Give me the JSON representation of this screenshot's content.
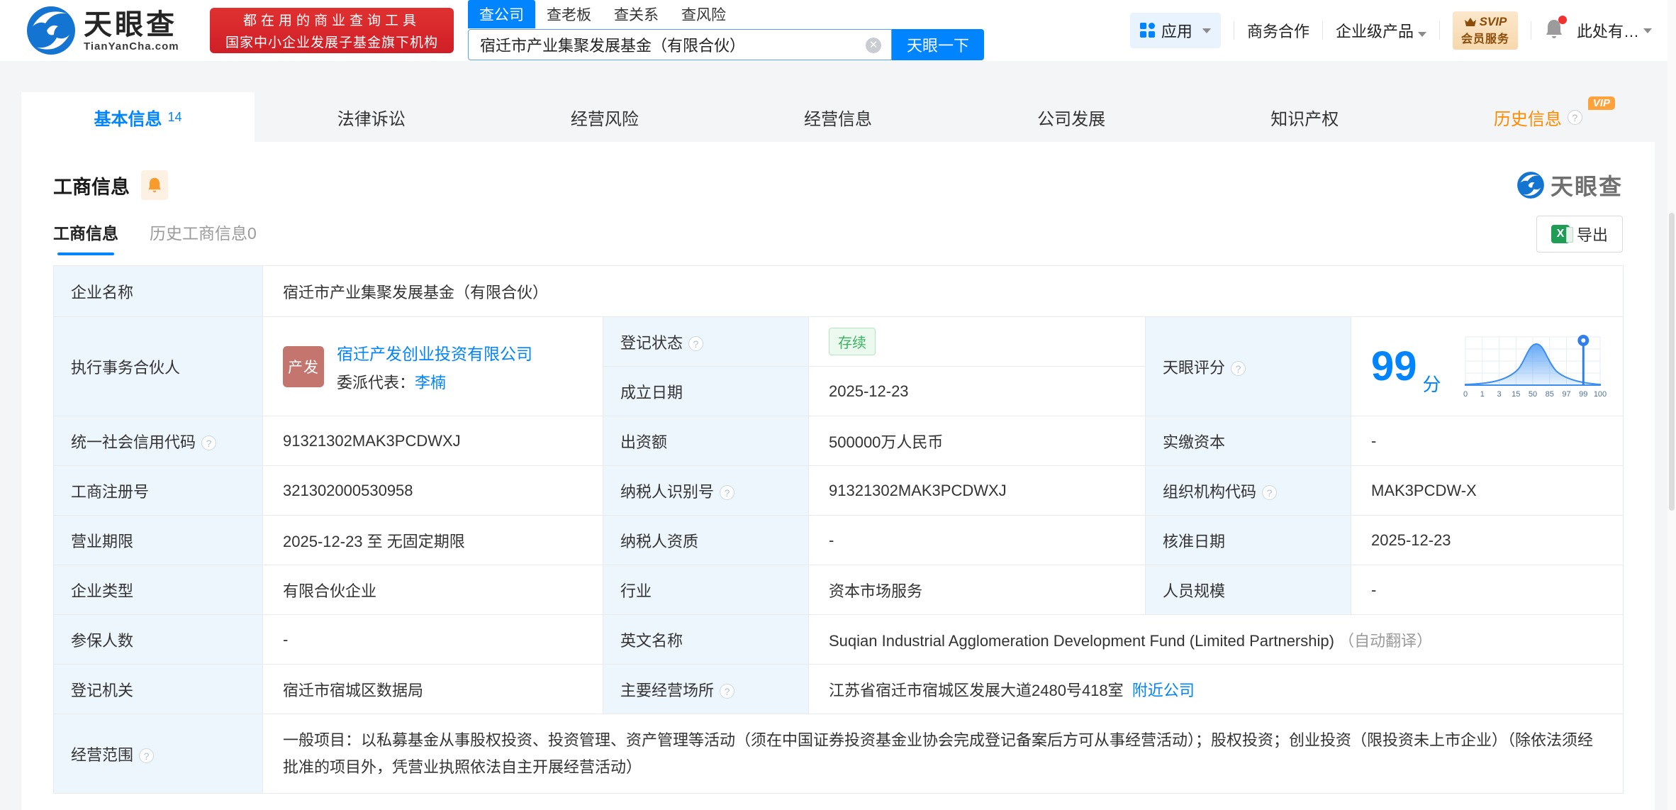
{
  "brand": {
    "logo_text": "天眼查",
    "domain": "TianYanCha.com",
    "promo_line1": "都在用的商业查询工具",
    "promo_line2": "国家中小企业发展子基金旗下机构"
  },
  "search": {
    "tabs": [
      "查公司",
      "查老板",
      "查关系",
      "查风险"
    ],
    "active_tab": "查公司",
    "value": "宿迁市产业集聚发展基金（有限合伙）",
    "button": "天眼一下"
  },
  "topnav": {
    "apps": "应用",
    "coop": "商务合作",
    "enterprise": "企业级产品",
    "svip_top": "SVIP",
    "svip_bottom": "会员服务",
    "more": "此处有…"
  },
  "tabs": [
    {
      "label": "基本信息",
      "count": "14",
      "active": true
    },
    {
      "label": "法律诉讼"
    },
    {
      "label": "经营风险"
    },
    {
      "label": "经营信息"
    },
    {
      "label": "公司发展"
    },
    {
      "label": "知识产权"
    },
    {
      "label": "历史信息",
      "vip_badge": "VIP"
    }
  ],
  "section": {
    "title": "工商信息",
    "subtab_active": "工商信息",
    "subtab_history": "历史工商信息0",
    "export": "导出",
    "watermark": "天眼查"
  },
  "fields": {
    "company_name": {
      "label": "企业名称",
      "value": "宿迁市产业集聚发展基金（有限合伙）"
    },
    "executive_partner": {
      "label": "执行事务合伙人",
      "avatar_text": "产发",
      "company": "宿迁产发创业投资有限公司",
      "deputy_label": "委派代表：",
      "deputy": "李楠"
    },
    "registration_status": {
      "label": "登记状态",
      "value": "存续"
    },
    "establish_date": {
      "label": "成立日期",
      "value": "2025-12-23"
    },
    "tianyan_score": {
      "label": "天眼评分",
      "score": "99",
      "unit": "分"
    },
    "credit_code": {
      "label": "统一社会信用代码",
      "value": "91321302MAK3PCDWXJ"
    },
    "contribution": {
      "label": "出资额",
      "value": "500000万人民币"
    },
    "paid_capital": {
      "label": "实缴资本",
      "value": "-"
    },
    "registration_number": {
      "label": "工商注册号",
      "value": "321302000530958"
    },
    "taxpayer_id": {
      "label": "纳税人识别号",
      "value": "91321302MAK3PCDWXJ"
    },
    "org_code": {
      "label": "组织机构代码",
      "value": "MAK3PCDW-X"
    },
    "business_term": {
      "label": "营业期限",
      "value": "2025-12-23 至 无固定期限"
    },
    "taxpayer_qualification": {
      "label": "纳税人资质",
      "value": "-"
    },
    "approval_date": {
      "label": "核准日期",
      "value": "2025-12-23"
    },
    "company_type": {
      "label": "企业类型",
      "value": "有限合伙企业"
    },
    "industry": {
      "label": "行业",
      "value": "资本市场服务"
    },
    "staff_size": {
      "label": "人员规模",
      "value": "-"
    },
    "insured_count": {
      "label": "参保人数",
      "value": "-"
    },
    "english_name": {
      "label": "英文名称",
      "value": "Suqian Industrial Agglomeration Development Fund (Limited Partnership)",
      "note": "（自动翻译）"
    },
    "registration_authority": {
      "label": "登记机关",
      "value": "宿迁市宿城区数据局"
    },
    "business_location": {
      "label": "主要经营场所",
      "value": "江苏省宿迁市宿城区发展大道2480号418室",
      "link": "附近公司"
    },
    "business_scope": {
      "label": "经营范围",
      "value": "一般项目：以私募基金从事股权投资、投资管理、资产管理等活动（须在中国证券投资基金业协会完成登记备案后方可从事经营活动）；股权投资；创业投资（限投资未上市企业）（除依法须经批准的项目外，凭营业执照依法自主开展经营活动）"
    }
  },
  "chart_data": {
    "type": "area",
    "title": "天眼评分",
    "score": 99,
    "score_unit": "分",
    "x_ticks": [
      "0",
      "1",
      "3",
      "15",
      "50",
      "85",
      "97",
      "99",
      "100"
    ],
    "marker_at": "99",
    "description": "bell-shaped score distribution curve with marker pin at 99",
    "grid": true
  },
  "icons": {
    "logo": "tianyancha-swirl-icon",
    "clear": "clear-icon",
    "apps": "grid-icon",
    "crown": "crown-icon",
    "bell": "bell-icon",
    "help": "question-icon",
    "excel": "excel-icon",
    "marker": "pin-marker-icon"
  },
  "colors": {
    "brand_blue": "#0084ff",
    "promo_red": "#d92a2c",
    "vip_orange": "#ff8a00",
    "status_green": "#3bb360",
    "label_bg": "#eef6fd",
    "avatar_rose": "#c3756e"
  }
}
